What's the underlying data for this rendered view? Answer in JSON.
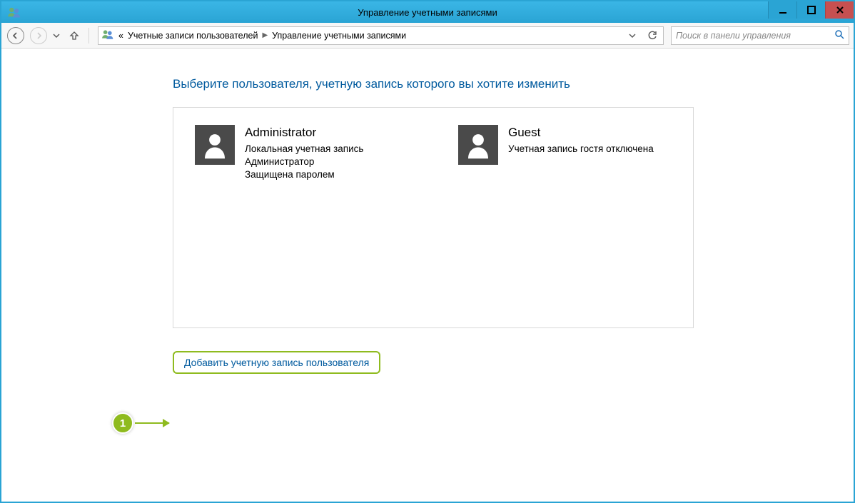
{
  "window": {
    "title": "Управление учетными записями"
  },
  "nav": {
    "breadcrumb_prefix": "«",
    "crumb1": "Учетные записи пользователей",
    "crumb2": "Управление учетными записями",
    "search_placeholder": "Поиск в панели управления"
  },
  "heading": "Выберите пользователя, учетную запись которого вы хотите изменить",
  "users": {
    "admin": {
      "name": "Administrator",
      "line1": "Локальная учетная запись",
      "line2": "Администратор",
      "line3": "Защищена паролем"
    },
    "guest": {
      "name": "Guest",
      "line1": "Учетная запись гостя отключена"
    }
  },
  "add_user_label": "Добавить учетную запись пользователя",
  "callout": {
    "number": "1"
  }
}
